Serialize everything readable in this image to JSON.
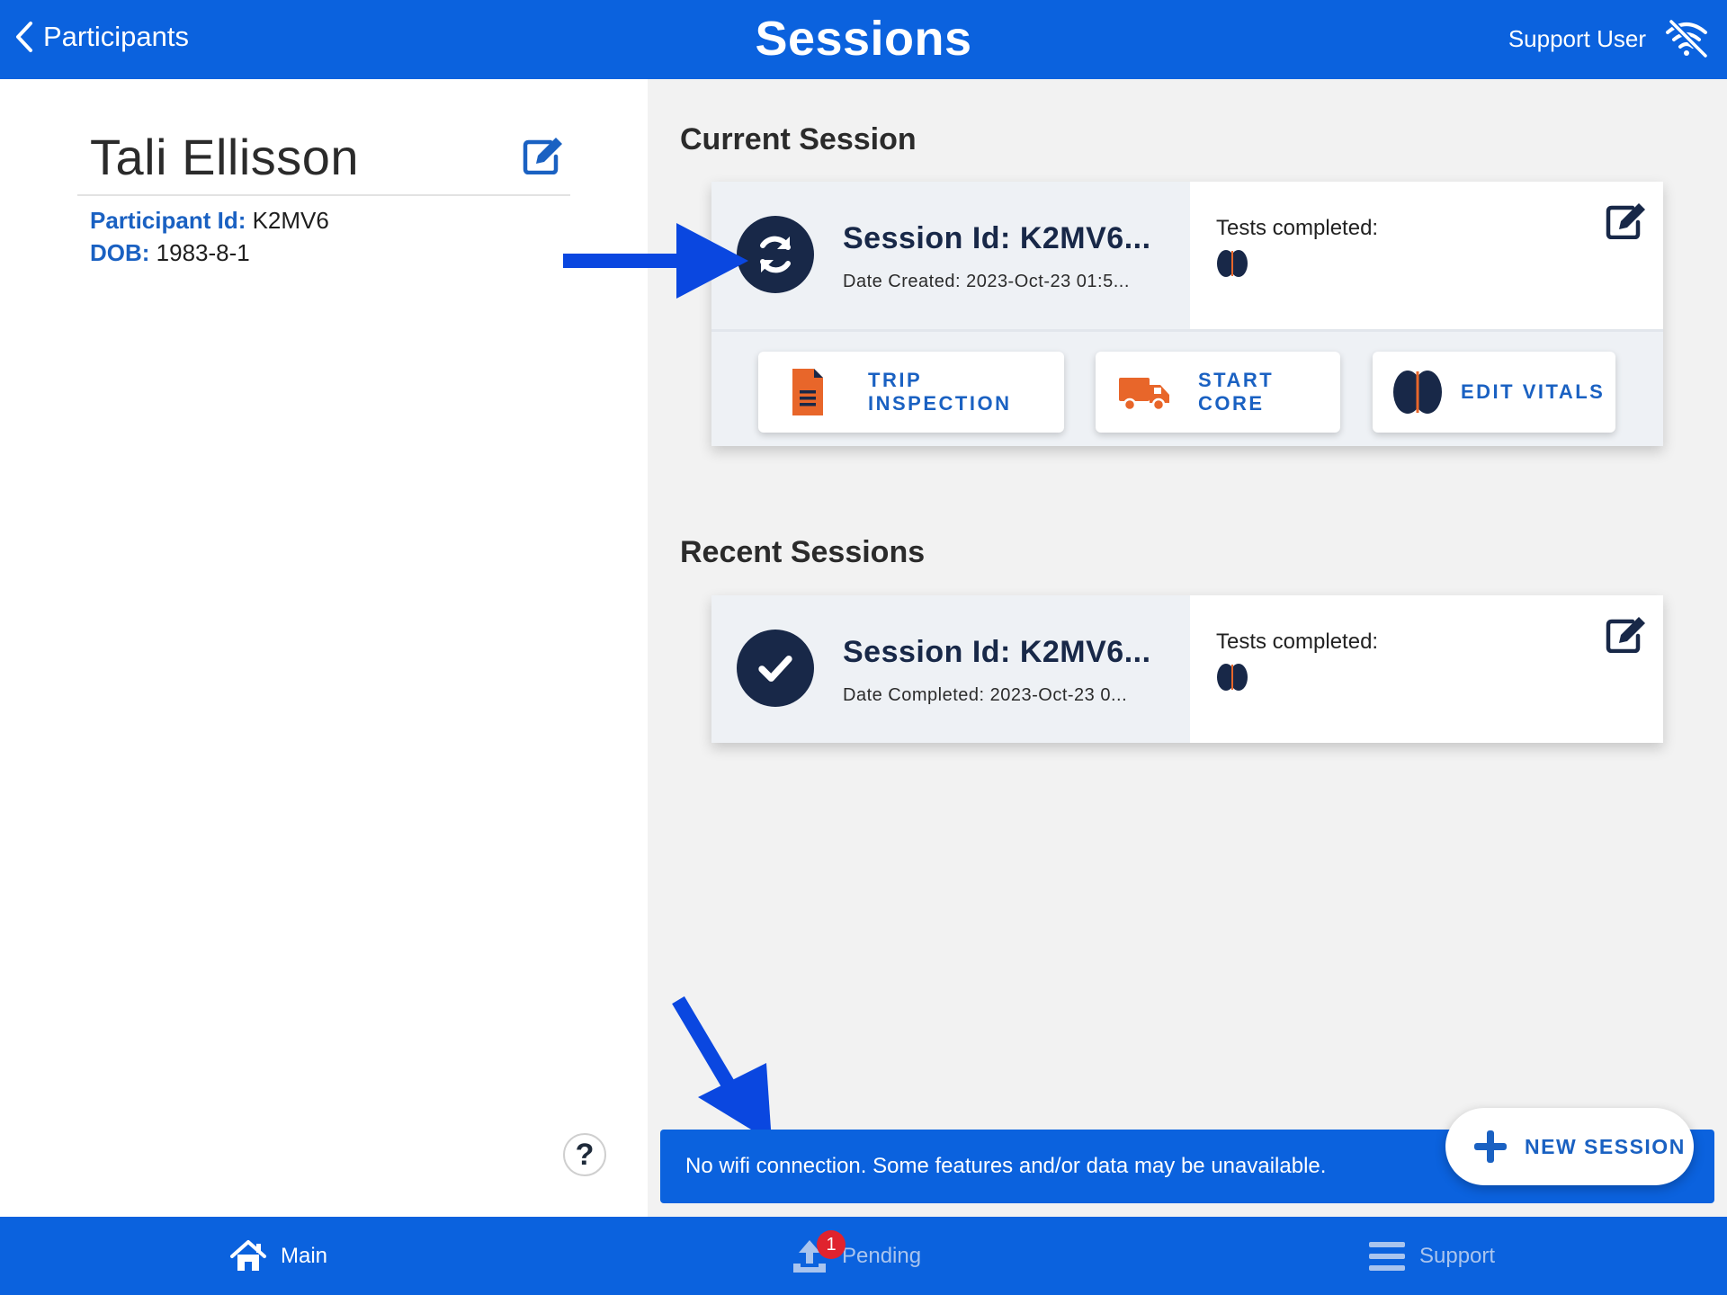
{
  "header": {
    "back_label": "Participants",
    "title": "Sessions",
    "user_label": "Support User"
  },
  "participant": {
    "name": "Tali Ellisson",
    "id_label": "Participant Id:",
    "id_value": "K2MV6",
    "dob_label": "DOB:",
    "dob_value": "1983-8-1"
  },
  "current_session": {
    "section_title": "Current Session",
    "session_id": "Session Id: K2MV6...",
    "date": "Date Created: 2023-Oct-23 01:5...",
    "tests_label": "Tests completed:",
    "actions": [
      {
        "label": "TRIP INSPECTION",
        "icon": "document-icon"
      },
      {
        "label": "START CORE",
        "icon": "truck-icon"
      },
      {
        "label": "EDIT VITALS",
        "icon": "brain-icon"
      }
    ]
  },
  "recent_sessions": {
    "section_title": "Recent Sessions",
    "items": [
      {
        "session_id": "Session Id: K2MV6...",
        "date": "Date Completed: 2023-Oct-23 0...",
        "tests_label": "Tests completed:"
      }
    ]
  },
  "banner": {
    "message": "No wifi connection. Some features and/or data may be unavailable."
  },
  "fab": {
    "label": "NEW SESSION"
  },
  "bottom_nav": {
    "main": "Main",
    "pending": "Pending",
    "pending_badge": "1",
    "support": "Support"
  },
  "help": {
    "symbol": "?"
  },
  "colors": {
    "primary": "#0b62de",
    "navy": "#182848",
    "orange": "#e8662a",
    "badge": "#e0232e"
  }
}
